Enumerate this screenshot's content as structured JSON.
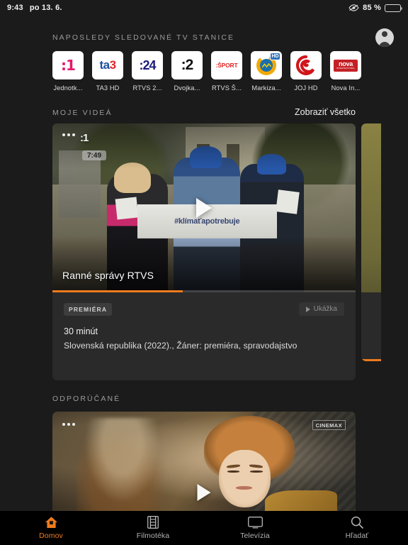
{
  "status_bar": {
    "time": "9:43",
    "date": "po 13. 6.",
    "battery_percent": "85 %",
    "battery_level": 85,
    "eye_icon": "eye-icon",
    "battery_icon": "battery-icon"
  },
  "header": {
    "recent_channels_label": "NAPOSLEDY SLEDOVANÉ TV STANICE",
    "avatar_icon": "profile-avatar-icon"
  },
  "channels": [
    {
      "name": "Jednotk...",
      "logo": "jednotka-logo",
      "logo_text": ":1"
    },
    {
      "name": "TA3 HD",
      "logo": "ta3-logo",
      "logo_text": "ta3"
    },
    {
      "name": "RTVS 2...",
      "logo": "rtvs24-logo",
      "logo_text": ":24"
    },
    {
      "name": "Dvojka...",
      "logo": "dvojka-logo",
      "logo_text": ":2"
    },
    {
      "name": "RTVS Š...",
      "logo": "rtvs-sport-logo",
      "logo_text": ":ŠPORT"
    },
    {
      "name": "Markiza...",
      "logo": "markiza-logo",
      "logo_text": "",
      "badge": "HD"
    },
    {
      "name": "JOJ HD",
      "logo": "joj-logo",
      "logo_text": ""
    },
    {
      "name": "Nova In...",
      "logo": "nova-international-logo",
      "logo_text": "nova",
      "logo_subtext": "INTERNATIONAL"
    }
  ],
  "my_videos": {
    "section_label": "MOJE VIDEÁ",
    "see_all_label": "Zobraziť všetko",
    "card": {
      "title": "Ranné správy RTVS",
      "time_badge": "7:49",
      "channel_watermark": ":1",
      "banner_text": "#klímaťapotrebuje",
      "progress_percent": 43,
      "more_icon": "more-options-icon",
      "play_icon": "play-icon",
      "tag": "PREMIÉRA",
      "preview_button": "Ukážka",
      "preview_icon": "play-small-icon",
      "duration": "30 minút",
      "description": "Slovenská republika (2022)., Žáner: premiéra, spravodajstvo"
    },
    "next_card_peek": {
      "progress_percent": 100
    }
  },
  "recommended": {
    "section_label": "ODPORÚČANÉ",
    "card": {
      "provider_badge": "CINEMAX",
      "more_icon": "more-options-icon",
      "play_icon": "play-icon"
    }
  },
  "tab_bar": {
    "active_color": "#ee7b1e",
    "inactive_color": "#b3b3b3",
    "items": [
      {
        "label": "Domov",
        "icon": "home-icon",
        "active": true
      },
      {
        "label": "Filmotéka",
        "icon": "film-strip-icon",
        "active": false
      },
      {
        "label": "Televízia",
        "icon": "tv-monitor-icon",
        "active": false
      },
      {
        "label": "Hľadať",
        "icon": "search-icon",
        "active": false
      }
    ]
  }
}
